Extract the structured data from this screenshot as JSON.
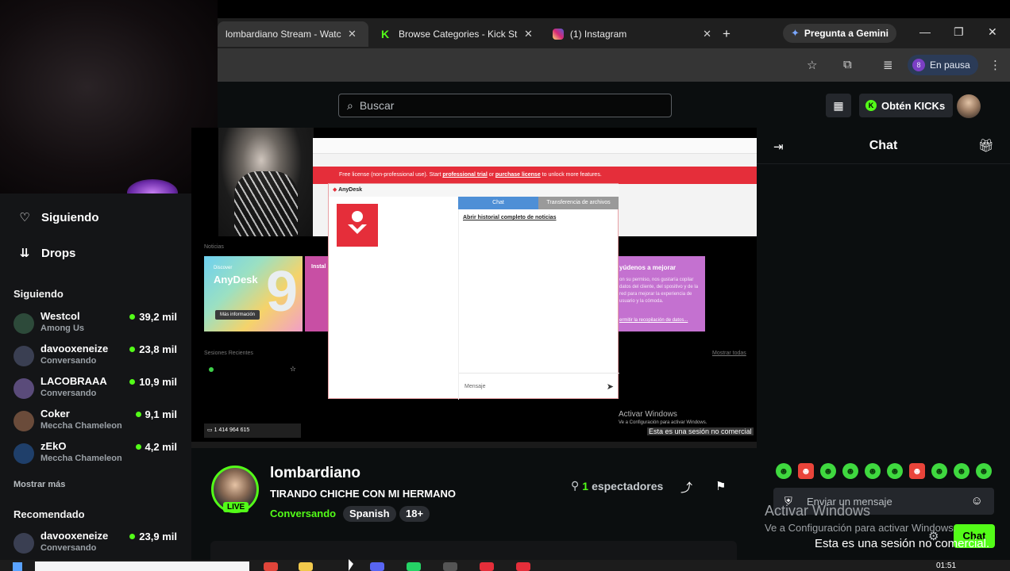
{
  "browser": {
    "tabs": [
      {
        "title": "lombardiano Stream - Watch l",
        "active": true
      },
      {
        "title": "Browse Categories - Kick Strea",
        "active": false
      },
      {
        "title": "(1) Instagram",
        "active": false
      }
    ],
    "gemini_label": "Pregunta a Gemini",
    "profile_label": "En pausa",
    "profile_initial": "8"
  },
  "header": {
    "search_placeholder": "Buscar",
    "kicks_label": "Obtén KICKs"
  },
  "sidebar": {
    "nav": [
      {
        "label": "Siguiendo",
        "icon": "heart-icon"
      },
      {
        "label": "Drops",
        "icon": "drops-icon"
      }
    ],
    "following_heading": "Siguiendo",
    "following": [
      {
        "name": "Westcol",
        "category": "Among Us",
        "viewers": "39,2 mil",
        "avatar_color": "#2d4a3a"
      },
      {
        "name": "davooxeneize",
        "category": "Conversando",
        "viewers": "23,8 mil",
        "avatar_color": "#3a3f52"
      },
      {
        "name": "LACOBRAAA",
        "category": "Conversando",
        "viewers": "10,9 mil",
        "avatar_color": "#5a4b7a"
      },
      {
        "name": "Coker",
        "category": "Meccha Chameleon",
        "viewers": "9,1 mil",
        "avatar_color": "#6a4b3a"
      },
      {
        "name": "zEkO",
        "category": "Meccha Chameleon",
        "viewers": "4,2 mil",
        "avatar_color": "#1f3f6a"
      }
    ],
    "show_more": "Mostrar más",
    "recommended_heading": "Recomendado",
    "recommended": [
      {
        "name": "davooxeneize",
        "category": "Conversando",
        "viewers": "23,9 mil",
        "avatar_color": "#3a3f52"
      }
    ]
  },
  "video": {
    "anydesk": {
      "banner_text": "Free license (non-professional use). Start",
      "banner_link1": "professional trial",
      "banner_mid": "or",
      "banner_link2": "purchase license",
      "banner_end": "to unlock more features.",
      "window_title": "AnyDesk",
      "news_label": "Noticias",
      "sessions_label": "Sesiones Recientes",
      "show_all": "Mostrar todas",
      "card_discover": "Discover",
      "card_brand": "AnyDesk",
      "card_number": "9",
      "card_button": "Más información",
      "card_install": "Instal",
      "promo_title": "yúdenos a mejorar",
      "promo_text": "on su permiso, nos gustaría copilar datos del cliente, del spositivo y de la red para mejorar la experiencia de usuario y la cómoda.",
      "promo_link": "ermitir la recopilación de datos...",
      "session_id": "1 414 964 615",
      "chat_tab": "Chat",
      "transfer_tab": "Transferencia de archivos",
      "history_link": "Abrir historial completo de noticias",
      "message_placeholder": "Mensaje",
      "wm_line1": "Activar Windows",
      "wm_line2": "Ve a Configuración para activar Windows.",
      "wm_line3": "Esta es una sesión no comercial"
    }
  },
  "stream": {
    "streamer": "lombardiano",
    "live_badge": "LIVE",
    "title": "TIRANDO CHICHE CON MI HERMANO",
    "category": "Conversando",
    "tags": [
      "Spanish",
      "18+"
    ],
    "viewers_count": "1",
    "viewers_label": "espectadores"
  },
  "chat": {
    "title": "Chat",
    "input_placeholder": "Enviar un mensaje",
    "send_button": "Chat"
  },
  "windows_watermark": {
    "line1": "Activar Windows",
    "line2": "Ve a Configuración para activar Windows.",
    "line3": "Esta es una sesión no comercial."
  },
  "taskbar": {
    "clock": "01:51"
  }
}
